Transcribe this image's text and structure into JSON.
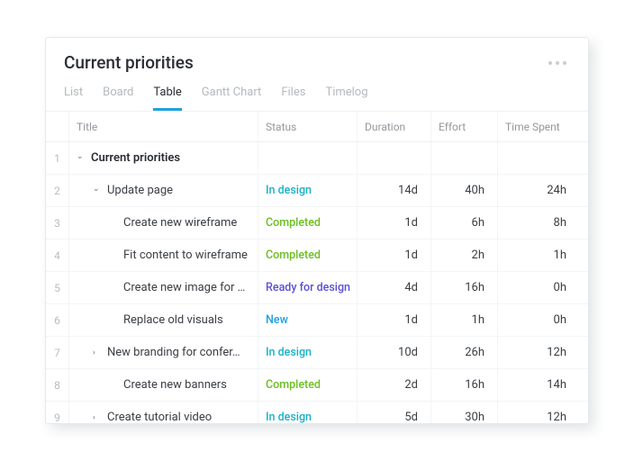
{
  "header": {
    "title": "Current priorities"
  },
  "tabs": [
    {
      "label": "List",
      "active": false
    },
    {
      "label": "Board",
      "active": false
    },
    {
      "label": "Table",
      "active": true
    },
    {
      "label": "Gantt Chart",
      "active": false
    },
    {
      "label": "Files",
      "active": false
    },
    {
      "label": "Timelog",
      "active": false
    }
  ],
  "columns": {
    "title": "Title",
    "status": "Status",
    "duration": "Duration",
    "effort": "Effort",
    "time_spent": "Time Spent"
  },
  "status_colors": {
    "In design": "#19b2c7",
    "Completed": "#6bbf1f",
    "Ready for design": "#5b4fd6",
    "New": "#1fa2e0"
  },
  "rows": [
    {
      "n": "1",
      "indent": 0,
      "chev": "down",
      "title": "Current priorities",
      "bold": true,
      "status": "",
      "duration": "",
      "effort": "",
      "time_spent": ""
    },
    {
      "n": "2",
      "indent": 1,
      "chev": "down",
      "title": "Update page",
      "bold": false,
      "status": "In design",
      "duration": "14d",
      "effort": "40h",
      "time_spent": "24h"
    },
    {
      "n": "3",
      "indent": 2,
      "chev": "",
      "title": "Create new wireframe",
      "bold": false,
      "status": "Completed",
      "duration": "1d",
      "effort": "6h",
      "time_spent": "8h"
    },
    {
      "n": "4",
      "indent": 2,
      "chev": "",
      "title": "Fit content to wireframe",
      "bold": false,
      "status": "Completed",
      "duration": "1d",
      "effort": "2h",
      "time_spent": "1h"
    },
    {
      "n": "5",
      "indent": 2,
      "chev": "",
      "title": "Create new image for p…",
      "bold": false,
      "status": "Ready for design",
      "duration": "4d",
      "effort": "16h",
      "time_spent": "0h"
    },
    {
      "n": "6",
      "indent": 2,
      "chev": "",
      "title": "Replace old visuals",
      "bold": false,
      "status": "New",
      "duration": "1d",
      "effort": "1h",
      "time_spent": "0h"
    },
    {
      "n": "7",
      "indent": 1,
      "chev": "right",
      "title": "New branding for confer…",
      "bold": false,
      "status": "In design",
      "duration": "10d",
      "effort": "26h",
      "time_spent": "12h"
    },
    {
      "n": "8",
      "indent": 2,
      "chev": "",
      "title": "Create new banners",
      "bold": false,
      "status": "Completed",
      "duration": "2d",
      "effort": "16h",
      "time_spent": "14h"
    },
    {
      "n": "9",
      "indent": 1,
      "chev": "right",
      "title": "Create tutorial video",
      "bold": false,
      "status": "In design",
      "duration": "5d",
      "effort": "30h",
      "time_spent": "12h"
    }
  ]
}
